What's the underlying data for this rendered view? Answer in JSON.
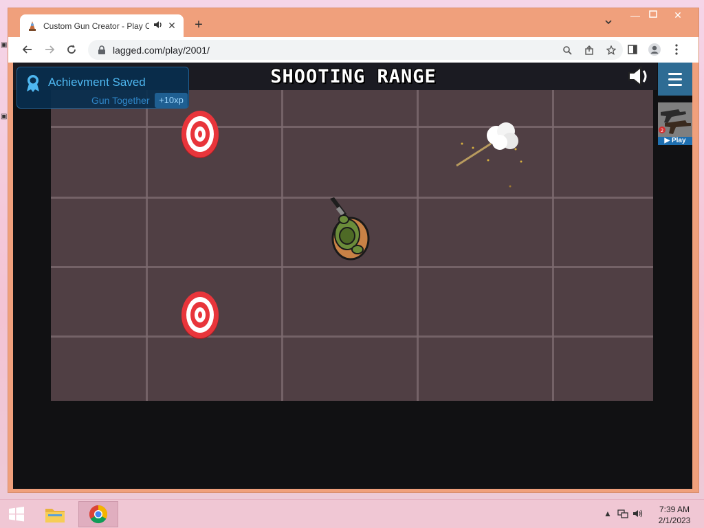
{
  "browser": {
    "tab": {
      "title": "Custom Gun Creator - Play C",
      "audio_icon": "speaker-icon",
      "close_icon": "close-icon"
    },
    "new_tab_icon": "plus-icon",
    "url": "lagged.com/play/2001/",
    "window_controls": [
      "minimize-icon",
      "maximize-icon",
      "close-icon"
    ]
  },
  "game": {
    "title": "SHOOTING RANGE",
    "toast": {
      "title": "Achievment Saved",
      "subtitle": "Gun Together",
      "xp": "+10xp"
    },
    "promo_play_label": "▶ Play"
  },
  "taskbar": {
    "time": "7:39 AM",
    "date": "2/1/2023"
  },
  "colors": {
    "window_frame": "#f0a07c",
    "arena_floor": "#503f44",
    "toast_bg": "#082e4e",
    "toast_text": "#4eb7f0",
    "menu_button": "#2e6c94"
  }
}
